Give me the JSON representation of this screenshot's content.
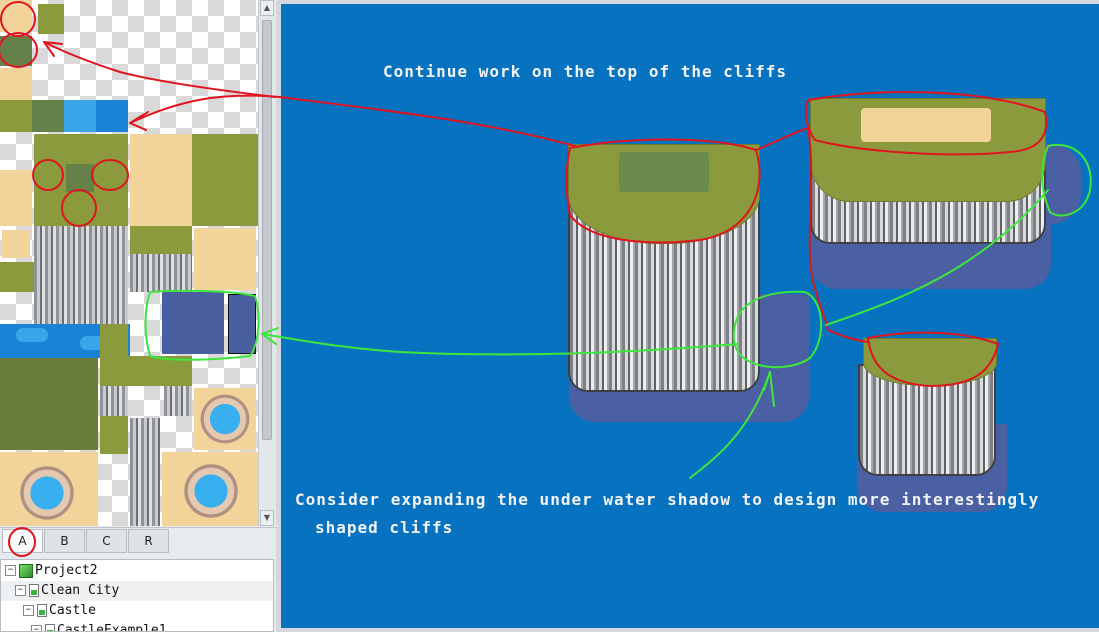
{
  "tileset_tabs": [
    "A",
    "B",
    "C",
    "R"
  ],
  "active_tab": "A",
  "tree": {
    "project": "Project2",
    "map_1": "Clean City",
    "map_2": "Castle",
    "map_3": "CastleExample1"
  },
  "canvas": {
    "note_top": "Continue work on the top of the cliffs",
    "note_bottom_line1": "Consider expanding the under water shadow to design more interestingly",
    "note_bottom_line2": "shaped cliffs"
  },
  "colors": {
    "canvas_bg": "#0772c0",
    "annotation_red": "#e0141e",
    "annotation_green": "#3ce63c",
    "grass": "#8c9a3e",
    "water_shadow": "#4a60a2"
  },
  "icons": {
    "scroll_up": "scroll-up-icon",
    "scroll_down": "scroll-down-icon",
    "collapse": "collapse-icon",
    "project": "project-icon",
    "map": "map-icon"
  }
}
